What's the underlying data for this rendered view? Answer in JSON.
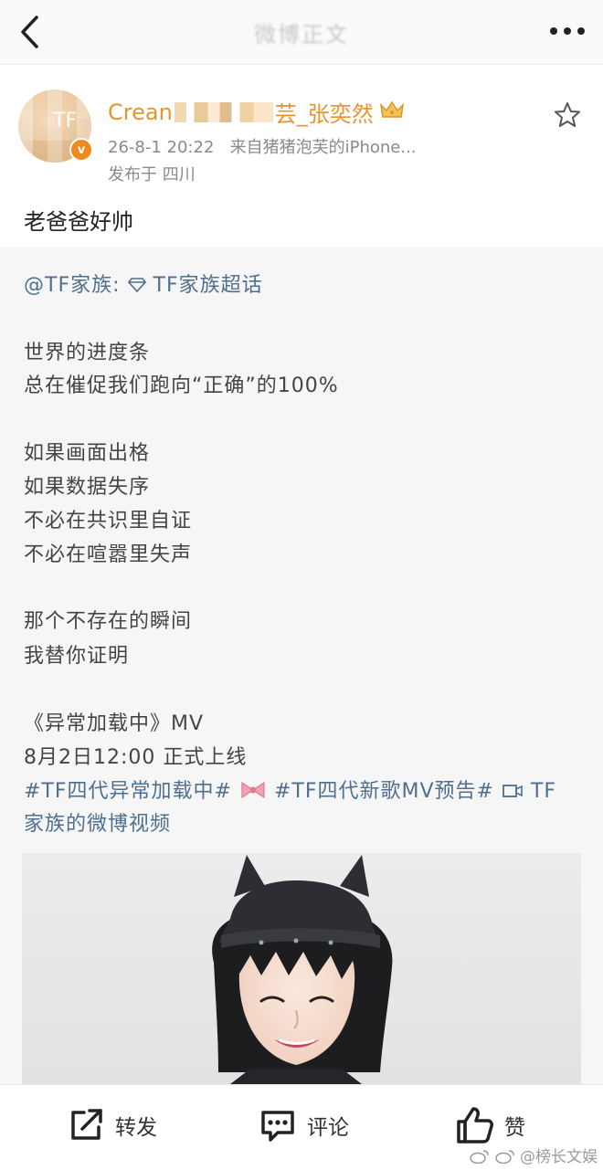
{
  "nav": {
    "title": "微博正文"
  },
  "post": {
    "username_visible_start": "Crean",
    "username_visible_end": "芸_张奕然",
    "timestamp": "26-8-1 20:22",
    "source": "来自猪猪泡芙的iPhone...",
    "location": "发布于 四川",
    "text": "老爸爸好帅"
  },
  "quoted": {
    "mention": "@TF家族:",
    "supertopic": "TF家族超话",
    "lines": [
      "世界的进度条",
      "总在催促我们跑向“正确”的100%",
      "如果画面出格",
      "如果数据失序",
      "不必在共识里自证",
      "不必在喧嚣里失声",
      "那个不存在的瞬间",
      "我替你证明",
      "《异常加载中》MV",
      "8月2日12:00 正式上线"
    ],
    "hashtag1": "#TF四代异常加载中#",
    "hashtag2": "#TF四代新歌MV预告#",
    "video_link_line1": "TF",
    "video_link_line2": "家族的微博视频"
  },
  "actions": {
    "repost": "转发",
    "comment": "评论",
    "like": "赞"
  },
  "watermark": "@榜长文娱",
  "colors": {
    "username": "#e8952e",
    "link": "#4e6f8f",
    "verified": "#f08a1c"
  }
}
